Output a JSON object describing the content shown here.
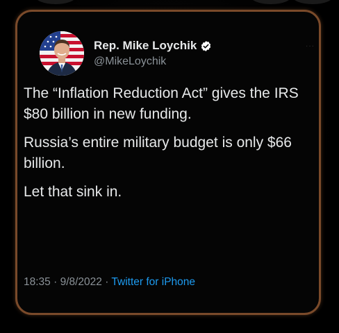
{
  "tweet": {
    "author": {
      "display_name": "Rep. Mike Loychik",
      "handle": "@MikeLoychik",
      "verified_icon": "verified-badge-icon",
      "avatar_icon": "profile-photo"
    },
    "body": {
      "paragraph_1": "The “Inflation Reduction Act” gives the IRS $80 billion in new funding.",
      "paragraph_2": "Russia’s entire military budget is only $66 billion.",
      "paragraph_3": "Let that sink in."
    },
    "meta": {
      "time": "18:35",
      "separator": " · ",
      "date": "9/8/2022",
      "source": "Twitter for iPhone"
    }
  },
  "colors": {
    "background": "#000000",
    "card_border": "#7a4a2a",
    "text_primary": "#e7e9ea",
    "text_secondary": "#8b9298",
    "link": "#1d9bf0",
    "verified_badge": "#ffffff"
  }
}
